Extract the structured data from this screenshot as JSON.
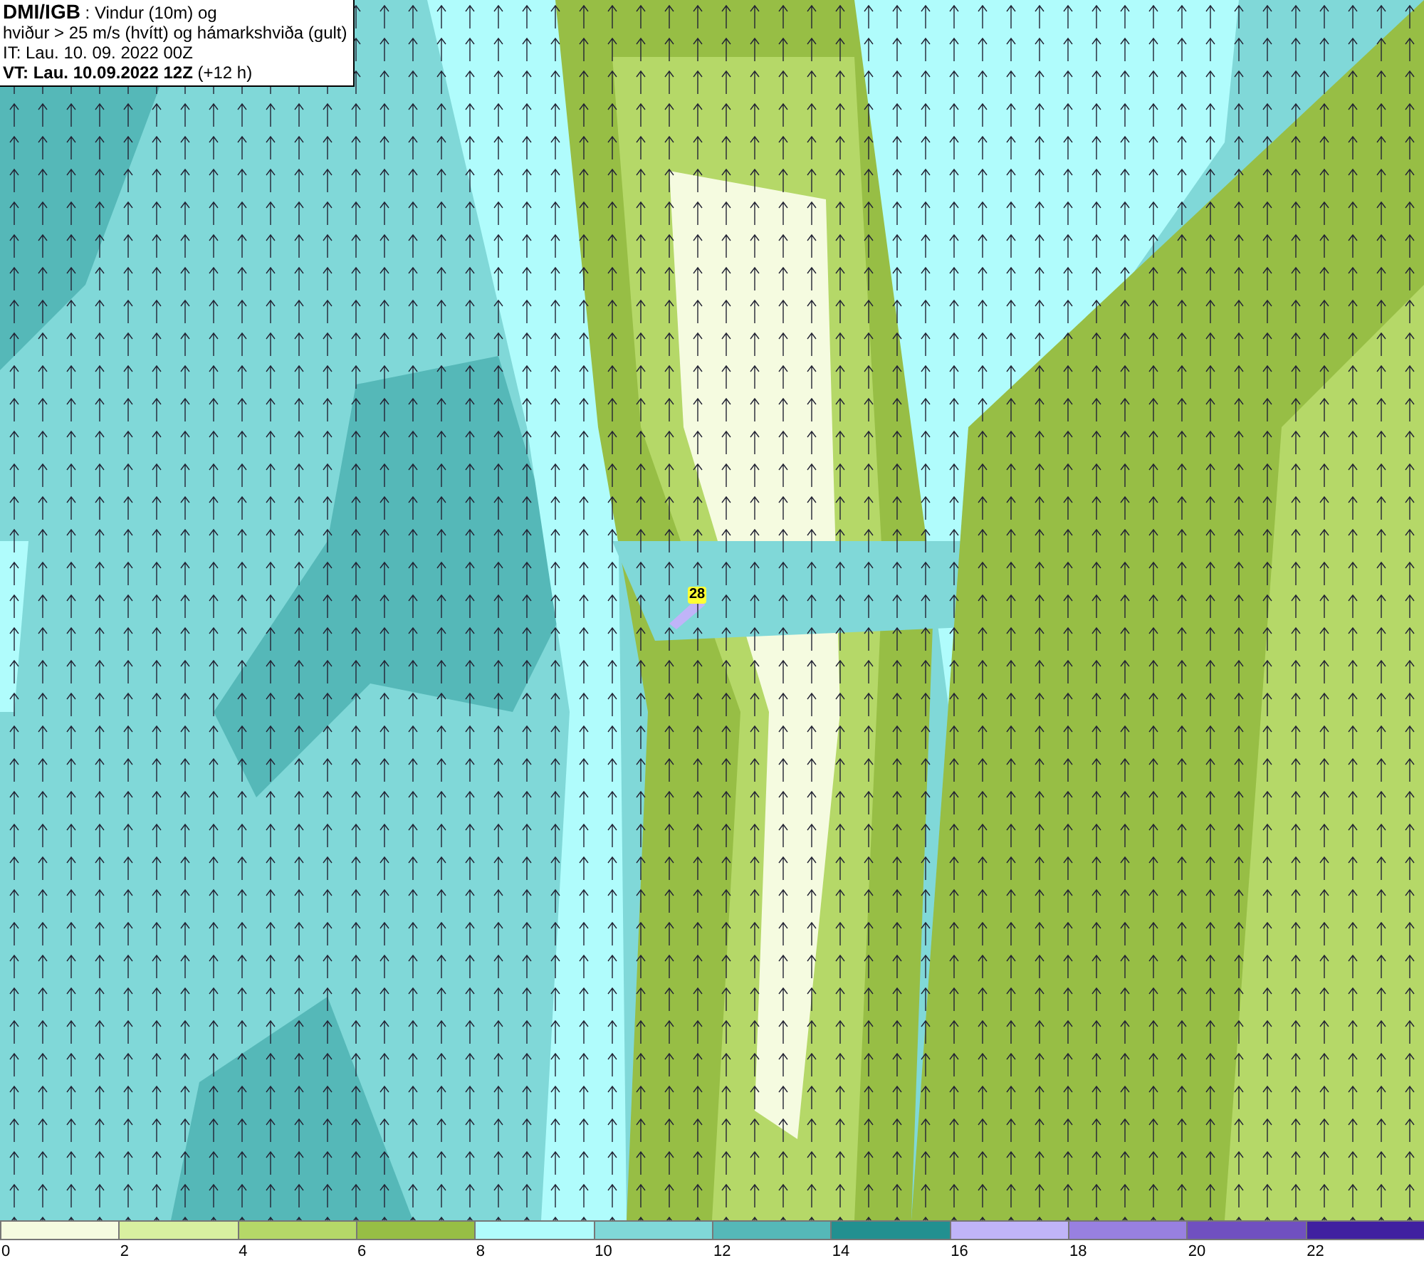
{
  "header": {
    "source": "DMI/IGB",
    "title": ": Vindur (10m) og",
    "subtitle": "hviður > 25 m/s (hvítt) og hámarkshviða (gult)",
    "init_time": "IT: Lau. 10. 09. 2022 00Z",
    "valid_time": "VT: Lau. 10.09.2022 12Z",
    "lead": "(+12 h)"
  },
  "map": {
    "gust_labels": [
      {
        "text": "28"
      }
    ]
  },
  "legend": {
    "bins": [
      {
        "color": "#f5fbe0"
      },
      {
        "color": "#d8f0a0"
      },
      {
        "color": "#b5d868"
      },
      {
        "color": "#97be45"
      },
      {
        "color": "#b0fcfc"
      },
      {
        "color": "#80d8d8"
      },
      {
        "color": "#55b8b8"
      },
      {
        "color": "#229090"
      },
      {
        "color": "#c0b4f8"
      },
      {
        "color": "#9880e0"
      },
      {
        "color": "#7050c0"
      },
      {
        "color": "#4020a0"
      }
    ],
    "ticks": [
      "0",
      "2",
      "4",
      "6",
      "8",
      "10",
      "12",
      "14",
      "16",
      "18",
      "20",
      "22"
    ]
  }
}
